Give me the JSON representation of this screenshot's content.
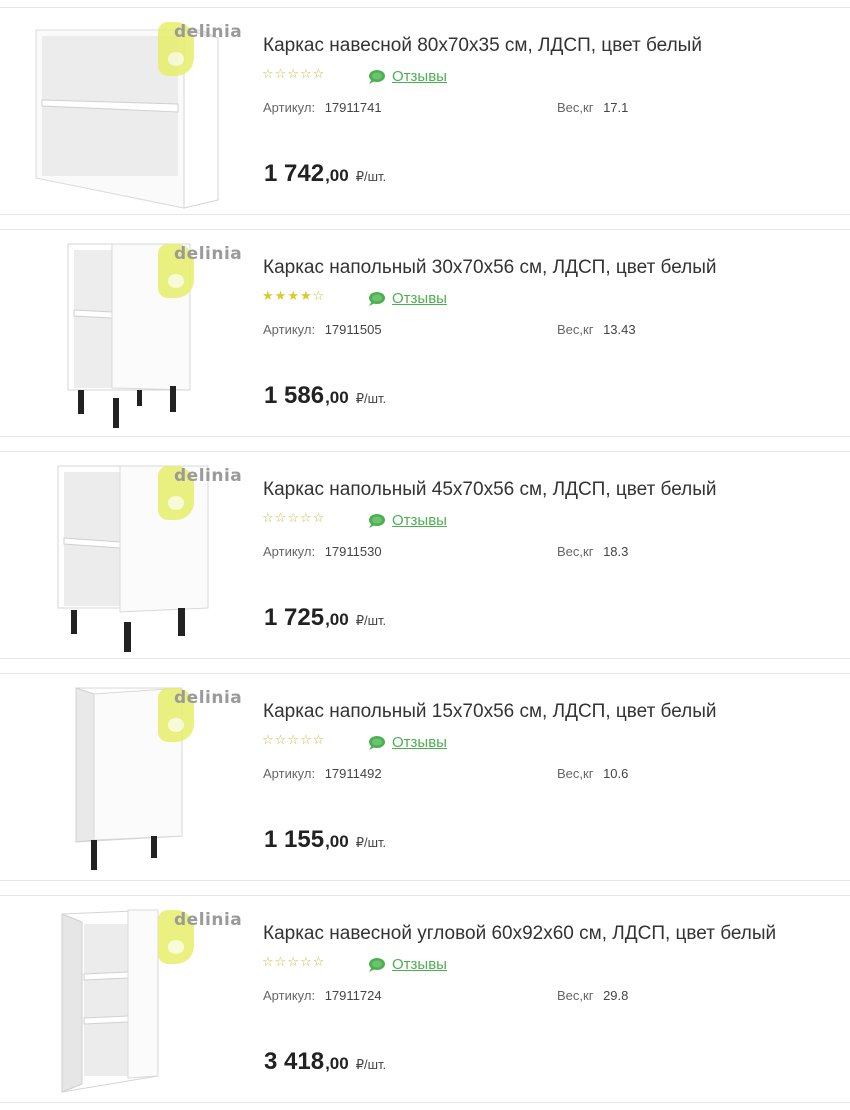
{
  "brand": "delinia",
  "products": [
    {
      "title": "Каркас навесной 80x70x35 см, ЛДСП, цвет белый",
      "rating": 0,
      "stars": [
        "☆",
        "☆",
        "☆",
        "☆",
        "☆"
      ],
      "reviews_label": "Отзывы",
      "article_label": "Артикул:",
      "article": "17911741",
      "weight_label": "Вес,кг",
      "weight": "17.1",
      "price_int": "1 742",
      "price_dec": ",00",
      "price_unit": "₽/шт.",
      "image": "wall-cabinet-frame"
    },
    {
      "title": "Каркас напольный 30x70x56 см, ЛДСП, цвет белый",
      "rating": 4,
      "stars": [
        "★",
        "★",
        "★",
        "★",
        "☆"
      ],
      "reviews_label": "Отзывы",
      "article_label": "Артикул:",
      "article": "17911505",
      "weight_label": "Вес,кг",
      "weight": "13.43",
      "price_int": "1 586",
      "price_dec": ",00",
      "price_unit": "₽/шт.",
      "image": "floor-cabinet-frame"
    },
    {
      "title": "Каркас напольный 45x70x56 см, ЛДСП, цвет белый",
      "rating": 0,
      "stars": [
        "☆",
        "☆",
        "☆",
        "☆",
        "☆"
      ],
      "reviews_label": "Отзывы",
      "article_label": "Артикул:",
      "article": "17911530",
      "weight_label": "Вес,кг",
      "weight": "18.3",
      "price_int": "1 725",
      "price_dec": ",00",
      "price_unit": "₽/шт.",
      "image": "floor-cabinet-frame"
    },
    {
      "title": "Каркас напольный 15x70x56 см, ЛДСП, цвет белый",
      "rating": 0,
      "stars": [
        "☆",
        "☆",
        "☆",
        "☆",
        "☆"
      ],
      "reviews_label": "Отзывы",
      "article_label": "Артикул:",
      "article": "17911492",
      "weight_label": "Вес,кг",
      "weight": "10.6",
      "price_int": "1 155",
      "price_dec": ",00",
      "price_unit": "₽/шт.",
      "image": "narrow-floor-cabinet-frame"
    },
    {
      "title": "Каркас навесной угловой 60x92x60 см, ЛДСП, цвет белый",
      "rating": 0,
      "stars": [
        "☆",
        "☆",
        "☆",
        "☆",
        "☆"
      ],
      "reviews_label": "Отзывы",
      "article_label": "Артикул:",
      "article": "17911724",
      "weight_label": "Вес,кг",
      "weight": "29.8",
      "price_int": "3 418",
      "price_dec": ",00",
      "price_unit": "₽/шт.",
      "image": "corner-wall-cabinet-frame"
    }
  ],
  "colors": {
    "accent_green": "#4caf50",
    "star_yellow": "#d8cc2a",
    "brand_yellow": "#e8ef6a"
  }
}
